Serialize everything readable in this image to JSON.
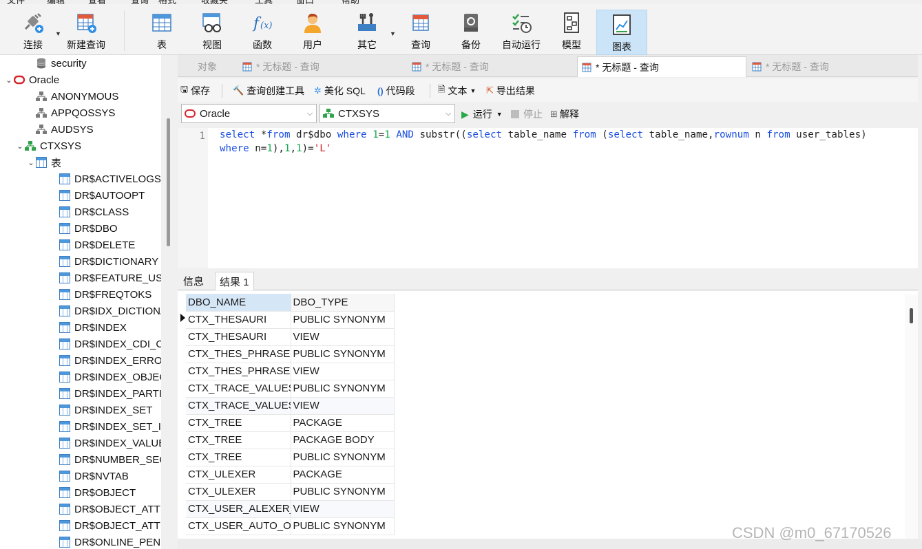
{
  "menu": [
    "文件",
    "编辑",
    "查看",
    "查询",
    "格式",
    "收藏夹",
    "工具",
    "窗口",
    "帮助"
  ],
  "toolbar": {
    "connect": "连接",
    "new_query": "新建查询",
    "table": "表",
    "view": "视图",
    "function": "函数",
    "user": "用户",
    "other": "其它",
    "query": "查询",
    "backup": "备份",
    "automation": "自动运行",
    "model": "模型",
    "chart": "图表"
  },
  "tree": [
    {
      "label": "security",
      "icon": "database-icon",
      "level": 2,
      "toggle": ""
    },
    {
      "label": "Oracle",
      "icon": "oracle-icon",
      "level": 0,
      "toggle": "v"
    },
    {
      "label": "ANONYMOUS",
      "icon": "schema-icon",
      "level": 2,
      "toggle": ""
    },
    {
      "label": "APPQOSSYS",
      "icon": "schema-icon",
      "level": 2,
      "toggle": ""
    },
    {
      "label": "AUDSYS",
      "icon": "schema-icon",
      "level": 2,
      "toggle": ""
    },
    {
      "label": "CTXSYS",
      "icon": "schema-icon-active",
      "level": 1,
      "toggle": "v"
    },
    {
      "label": "表",
      "icon": "table-icon",
      "level": 2,
      "toggle": "v"
    },
    {
      "label": "DR$ACTIVELOGS",
      "icon": "table-icon",
      "level": 3,
      "toggle": ""
    },
    {
      "label": "DR$AUTOOPT",
      "icon": "table-icon",
      "level": 3,
      "toggle": ""
    },
    {
      "label": "DR$CLASS",
      "icon": "table-icon",
      "level": 3,
      "toggle": ""
    },
    {
      "label": "DR$DBO",
      "icon": "table-icon",
      "level": 3,
      "toggle": ""
    },
    {
      "label": "DR$DELETE",
      "icon": "table-icon",
      "level": 3,
      "toggle": ""
    },
    {
      "label": "DR$DICTIONARY",
      "icon": "table-icon",
      "level": 3,
      "toggle": ""
    },
    {
      "label": "DR$FEATURE_USED",
      "icon": "table-icon",
      "level": 3,
      "toggle": ""
    },
    {
      "label": "DR$FREQTOKS",
      "icon": "table-icon",
      "level": 3,
      "toggle": ""
    },
    {
      "label": "DR$IDX_DICTIONA",
      "icon": "table-icon",
      "level": 3,
      "toggle": ""
    },
    {
      "label": "DR$INDEX",
      "icon": "table-icon",
      "level": 3,
      "toggle": ""
    },
    {
      "label": "DR$INDEX_CDI_CO",
      "icon": "table-icon",
      "level": 3,
      "toggle": ""
    },
    {
      "label": "DR$INDEX_ERROR",
      "icon": "table-icon",
      "level": 3,
      "toggle": ""
    },
    {
      "label": "DR$INDEX_OBJECT",
      "icon": "table-icon",
      "level": 3,
      "toggle": ""
    },
    {
      "label": "DR$INDEX_PARTIT",
      "icon": "table-icon",
      "level": 3,
      "toggle": ""
    },
    {
      "label": "DR$INDEX_SET",
      "icon": "table-icon",
      "level": 3,
      "toggle": ""
    },
    {
      "label": "DR$INDEX_SET_INI",
      "icon": "table-icon",
      "level": 3,
      "toggle": ""
    },
    {
      "label": "DR$INDEX_VALUE",
      "icon": "table-icon",
      "level": 3,
      "toggle": ""
    },
    {
      "label": "DR$NUMBER_SEQU",
      "icon": "table-icon",
      "level": 3,
      "toggle": ""
    },
    {
      "label": "DR$NVTAB",
      "icon": "table-icon",
      "level": 3,
      "toggle": ""
    },
    {
      "label": "DR$OBJECT",
      "icon": "table-icon",
      "level": 3,
      "toggle": ""
    },
    {
      "label": "DR$OBJECT_ATTRI",
      "icon": "table-icon",
      "level": 3,
      "toggle": ""
    },
    {
      "label": "DR$OBJECT_ATTRI",
      "icon": "table-icon",
      "level": 3,
      "toggle": ""
    },
    {
      "label": "DR$ONLINE_PENDI",
      "icon": "table-icon",
      "level": 3,
      "toggle": ""
    }
  ],
  "tabs": [
    {
      "label": "对象",
      "active": false,
      "has_icon": false
    },
    {
      "label": "* 无标题 - 查询",
      "active": false,
      "has_icon": true
    },
    {
      "label": "* 无标题 - 查询",
      "active": false,
      "has_icon": true
    },
    {
      "label": "* 无标题 - 查询",
      "active": true,
      "has_icon": true
    },
    {
      "label": "* 无标题 - 查询",
      "active": false,
      "has_icon": true
    }
  ],
  "query_toolbar": {
    "save": "保存",
    "builder": "查询创建工具",
    "beautify": "美化 SQL",
    "snippet": "代码段",
    "text": "文本",
    "export": "导出结果",
    "run": "运行",
    "stop": "停止",
    "explain": "解释"
  },
  "connection_select": "Oracle",
  "schema_select": "CTXSYS",
  "editor": {
    "line_number": "1",
    "line1": [
      {
        "t": "select",
        "c": "kw"
      },
      {
        "t": " *",
        "c": ""
      },
      {
        "t": "from",
        "c": "kw"
      },
      {
        "t": " dr$dbo ",
        "c": ""
      },
      {
        "t": "where",
        "c": "kw"
      },
      {
        "t": " ",
        "c": ""
      },
      {
        "t": "1",
        "c": "num"
      },
      {
        "t": "=",
        "c": ""
      },
      {
        "t": "1",
        "c": "num"
      },
      {
        "t": " ",
        "c": ""
      },
      {
        "t": "AND",
        "c": "kw"
      },
      {
        "t": " substr((",
        "c": ""
      },
      {
        "t": "select",
        "c": "kw"
      },
      {
        "t": " table_name ",
        "c": ""
      },
      {
        "t": "from",
        "c": "kw"
      },
      {
        "t": " (",
        "c": ""
      },
      {
        "t": "select",
        "c": "kw"
      },
      {
        "t": " table_name,",
        "c": ""
      },
      {
        "t": "rownum",
        "c": "kw"
      },
      {
        "t": " n ",
        "c": ""
      },
      {
        "t": "from",
        "c": "kw"
      },
      {
        "t": " user_tables)",
        "c": ""
      }
    ],
    "line2": [
      {
        "t": "where",
        "c": "kw"
      },
      {
        "t": " n=",
        "c": ""
      },
      {
        "t": "1",
        "c": "num"
      },
      {
        "t": "),",
        "c": ""
      },
      {
        "t": "1",
        "c": "num"
      },
      {
        "t": ",",
        "c": ""
      },
      {
        "t": "1",
        "c": "num"
      },
      {
        "t": ")=",
        "c": ""
      },
      {
        "t": "'L'",
        "c": "str"
      }
    ]
  },
  "result_tabs": [
    {
      "label": "信息",
      "active": false
    },
    {
      "label": "结果 1",
      "active": true
    }
  ],
  "grid": {
    "columns": [
      "DBO_NAME",
      "DBO_TYPE"
    ],
    "rows": [
      [
        "CTX_THESAURI",
        "PUBLIC SYNONYM"
      ],
      [
        "CTX_THESAURI",
        "VIEW"
      ],
      [
        "CTX_THES_PHRASES",
        "PUBLIC SYNONYM"
      ],
      [
        "CTX_THES_PHRASES",
        "VIEW"
      ],
      [
        "CTX_TRACE_VALUES",
        "PUBLIC SYNONYM"
      ],
      [
        "CTX_TRACE_VALUES",
        "VIEW"
      ],
      [
        "CTX_TREE",
        "PACKAGE"
      ],
      [
        "CTX_TREE",
        "PACKAGE BODY"
      ],
      [
        "CTX_TREE",
        "PUBLIC SYNONYM"
      ],
      [
        "CTX_ULEXER",
        "PACKAGE"
      ],
      [
        "CTX_ULEXER",
        "PUBLIC SYNONYM"
      ],
      [
        "CTX_USER_ALEXER_DICTS",
        "VIEW"
      ],
      [
        "CTX_USER_AUTO_OPT",
        "PUBLIC SYNONYM"
      ]
    ]
  },
  "watermark": "CSDN @m0_67170526",
  "colors": {
    "accent": "#cce4f7",
    "keyword": "#1a4ee0",
    "number": "#11a84a",
    "string": "#d11b24"
  }
}
